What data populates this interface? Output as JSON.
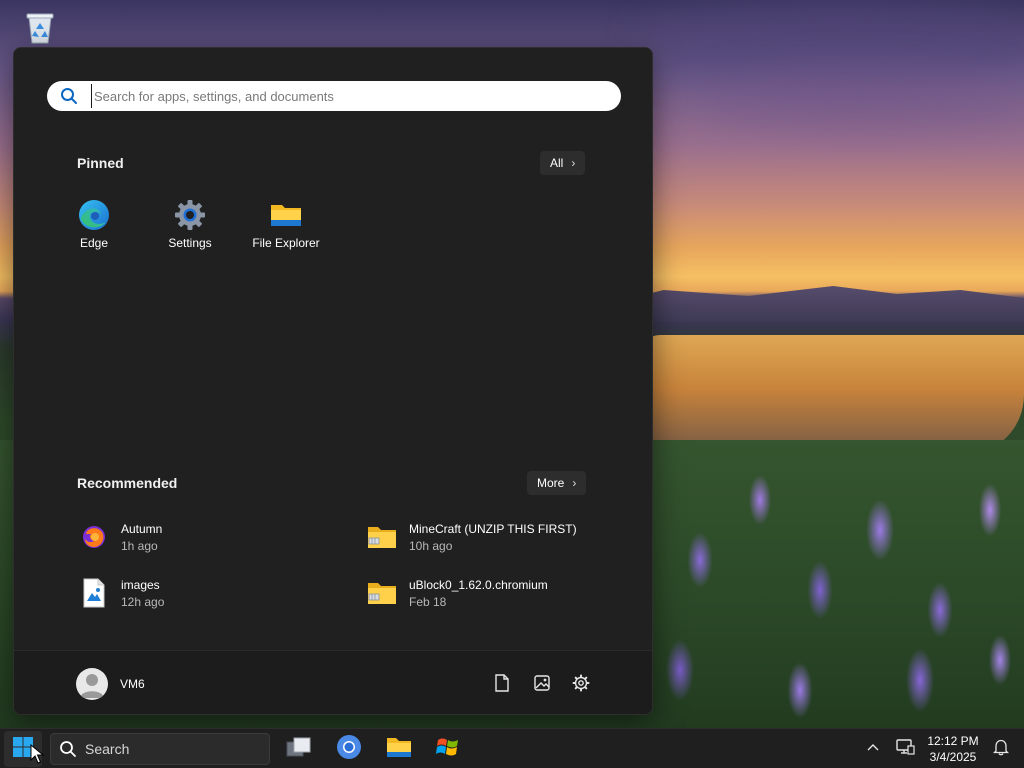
{
  "start_menu": {
    "search_placeholder": "Search for apps, settings, and documents",
    "pinned_title": "Pinned",
    "all_label": "All",
    "pinned_apps": [
      {
        "label": "Edge",
        "icon": "edge-icon"
      },
      {
        "label": "Settings",
        "icon": "gear-icon"
      },
      {
        "label": "File Explorer",
        "icon": "folder-icon"
      }
    ],
    "recommended_title": "Recommended",
    "more_label": "More",
    "recommended": [
      {
        "name": "Autumn",
        "time": "1h ago",
        "icon": "firefox-icon"
      },
      {
        "name": "MineCraft (UNZIP THIS FIRST)",
        "time": "10h ago",
        "icon": "zip-folder-icon"
      },
      {
        "name": "images",
        "time": "12h ago",
        "icon": "image-file-icon"
      },
      {
        "name": "uBlock0_1.62.0.chromium",
        "time": "Feb 18",
        "icon": "zip-folder-icon"
      }
    ],
    "user_name": "VM6",
    "footer_icons": [
      "document-icon",
      "picture-icon",
      "gear-icon"
    ]
  },
  "taskbar": {
    "search_label": "Search",
    "pinned": [
      "task-view-icon",
      "chromium-icon",
      "file-explorer-icon",
      "windows-flag-icon"
    ],
    "clock_time": "12:12 PM",
    "clock_date": "3/4/2025",
    "tray_icons": [
      "chevron-up-icon",
      "network-icon",
      "notification-bell-icon"
    ]
  },
  "colors": {
    "menu_bg": "#202020",
    "taskbar_bg": "#1f1f1f",
    "accent": "#0078d4"
  }
}
